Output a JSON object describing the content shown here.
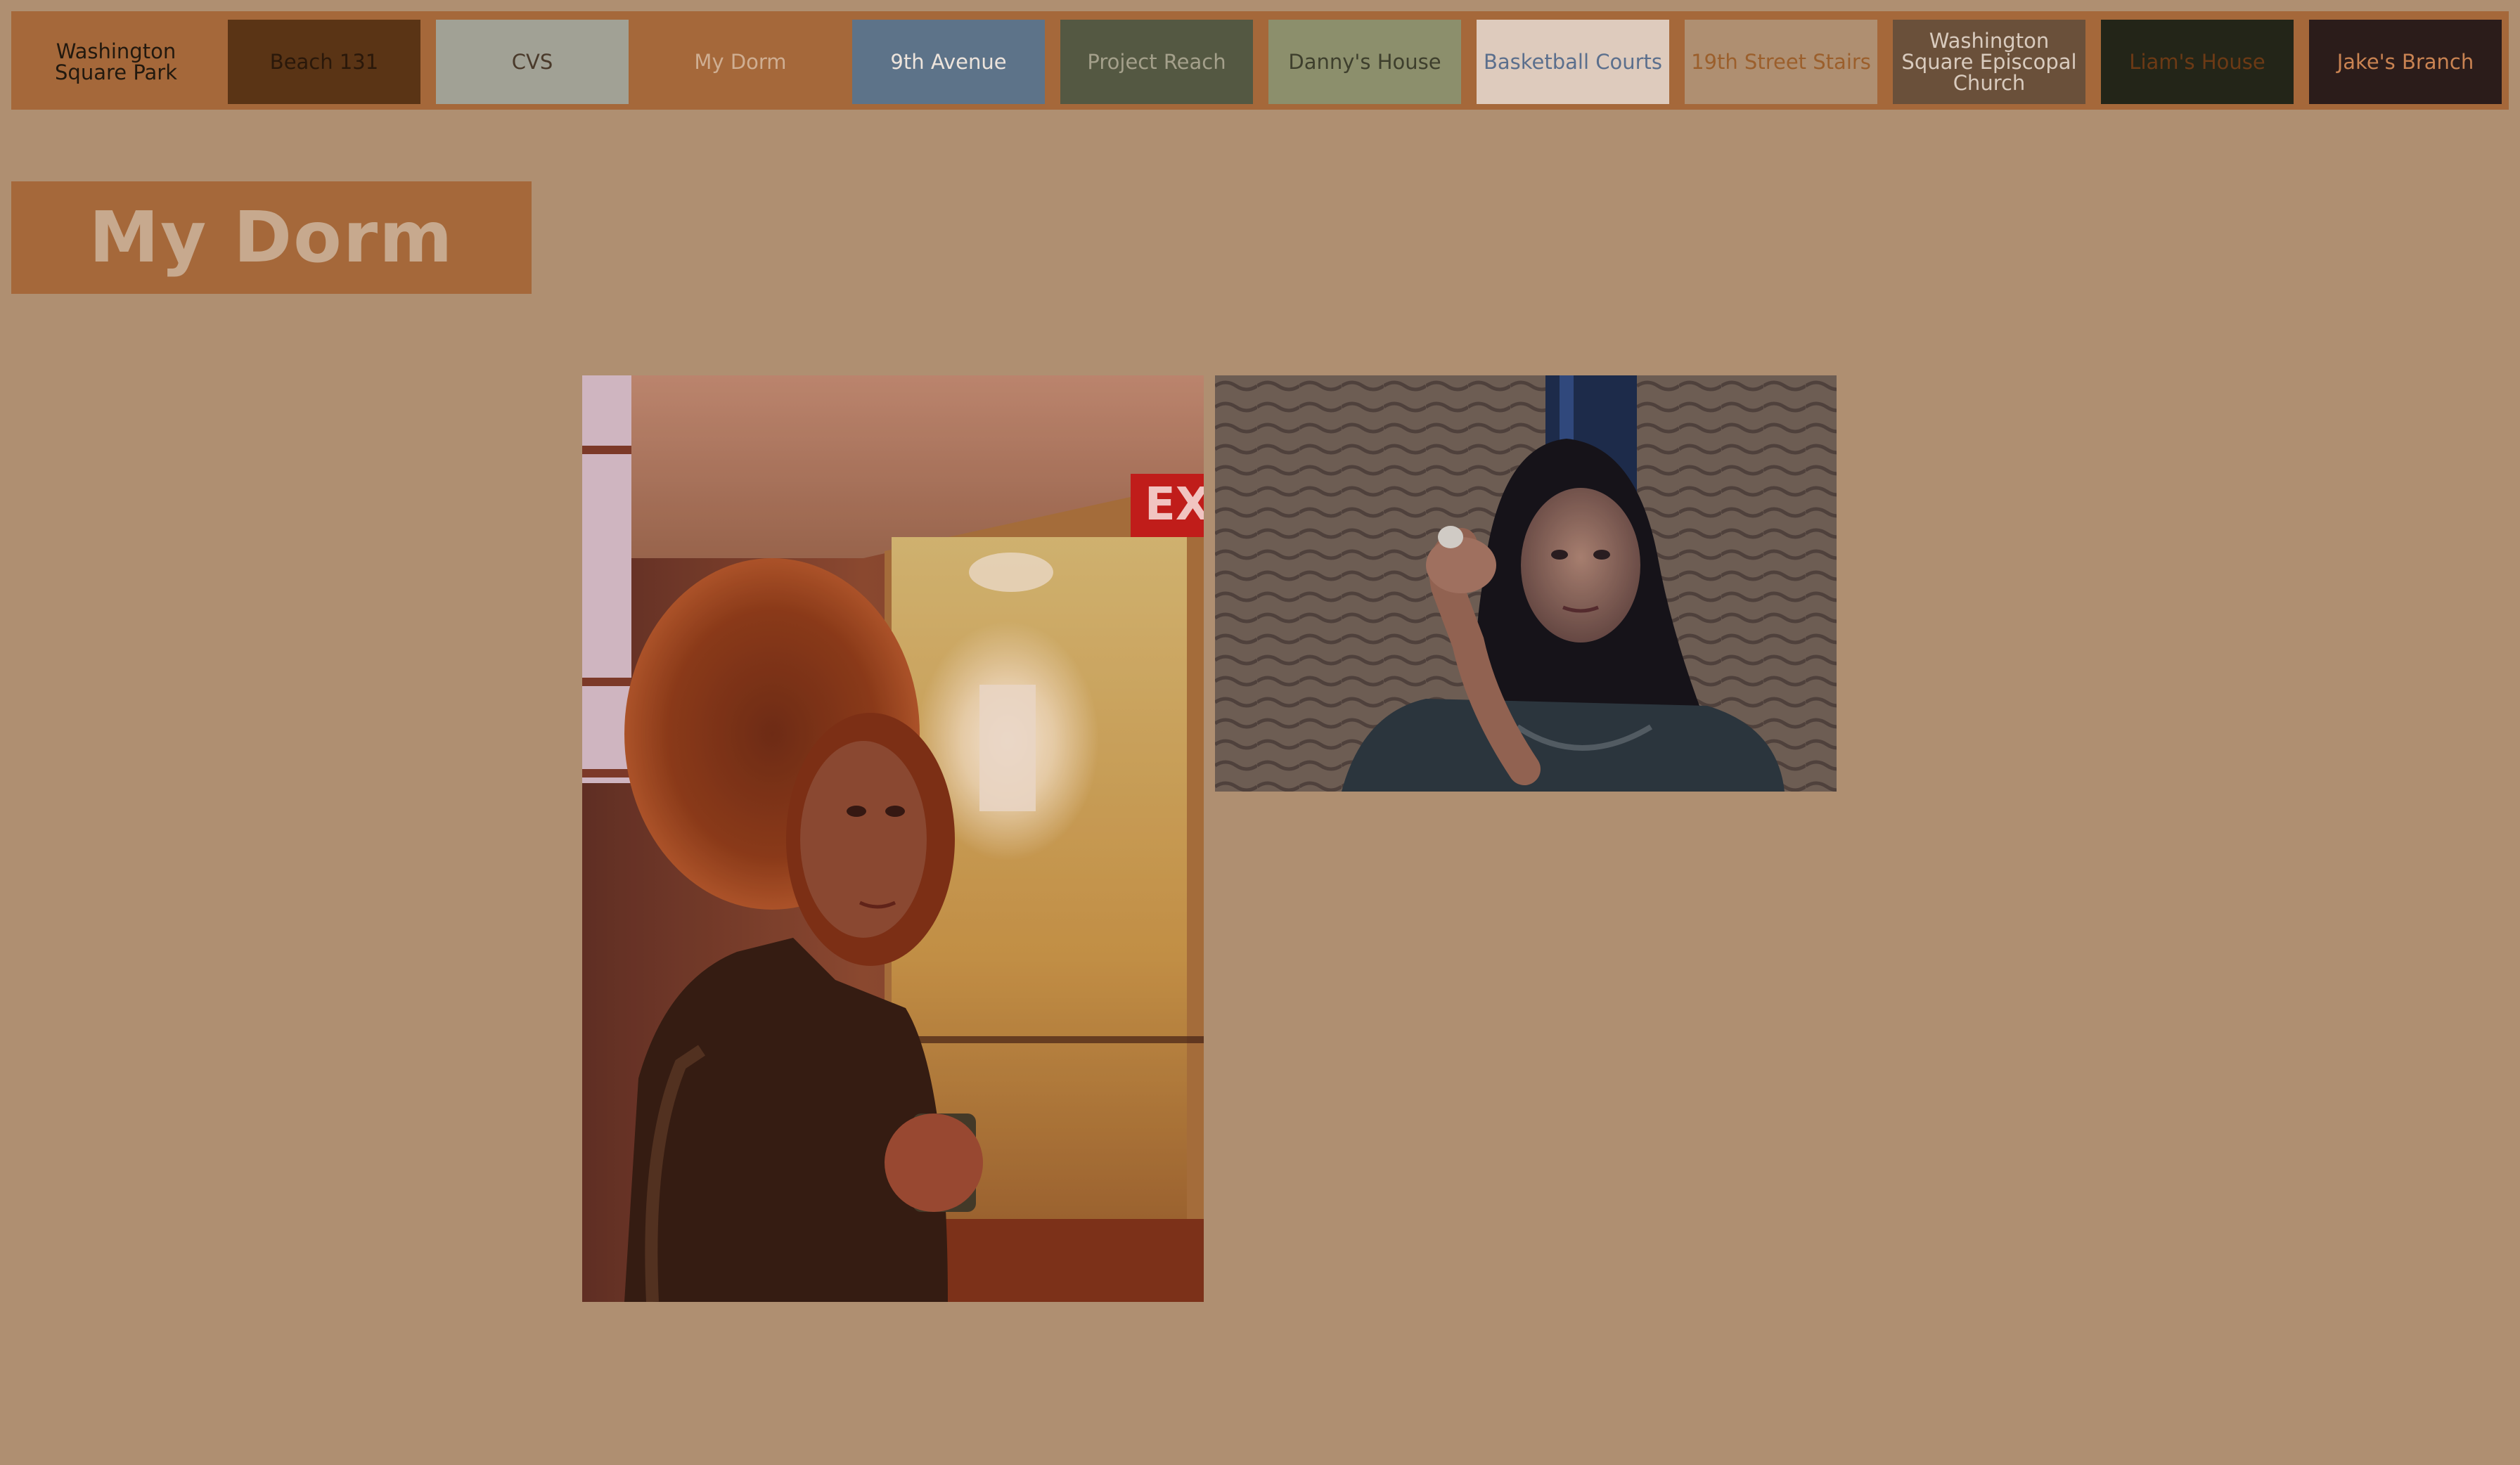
{
  "nav": {
    "tabs": [
      {
        "label": "Washington Square Park",
        "bg": "#a5683a",
        "fg": "#22190f"
      },
      {
        "label": "Beach 131",
        "bg": "#5a3415",
        "fg": "#2a180a"
      },
      {
        "label": "CVS",
        "bg": "#a1a195",
        "fg": "#4a3a2b"
      },
      {
        "label": "My Dorm",
        "bg": "#a5683a",
        "fg": "#cfae92"
      },
      {
        "label": "9th Avenue",
        "bg": "#5d7389",
        "fg": "#ede4dc"
      },
      {
        "label": "Project Reach",
        "bg": "#545842",
        "fg": "#a4a08b"
      },
      {
        "label": "Danny's House",
        "bg": "#8c8f6c",
        "fg": "#3e3f2d"
      },
      {
        "label": "Basketball Courts",
        "bg": "#decbbd",
        "fg": "#5b6f8d"
      },
      {
        "label": "19th Street Stairs",
        "bg": "#af8f71",
        "fg": "#9b5f2c"
      },
      {
        "label": "Washington Square Episcopal Church",
        "bg": "#6a503a",
        "fg": "#d9cbbe"
      },
      {
        "label": "Liam's House",
        "bg": "#232518",
        "fg": "#6c3a15"
      },
      {
        "label": "Jake's Branch",
        "bg": "#2b1c1a",
        "fg": "#c98352"
      }
    ]
  },
  "page": {
    "title": "My Dorm",
    "title_color": "#c7a98e"
  },
  "photos": [
    {
      "name": "photo-woman-hallway",
      "alt": "Woman with curly hair in a dorm hallway"
    },
    {
      "name": "photo-woman-waving",
      "alt": "Woman with dark hair waving in an elevator"
    }
  ]
}
